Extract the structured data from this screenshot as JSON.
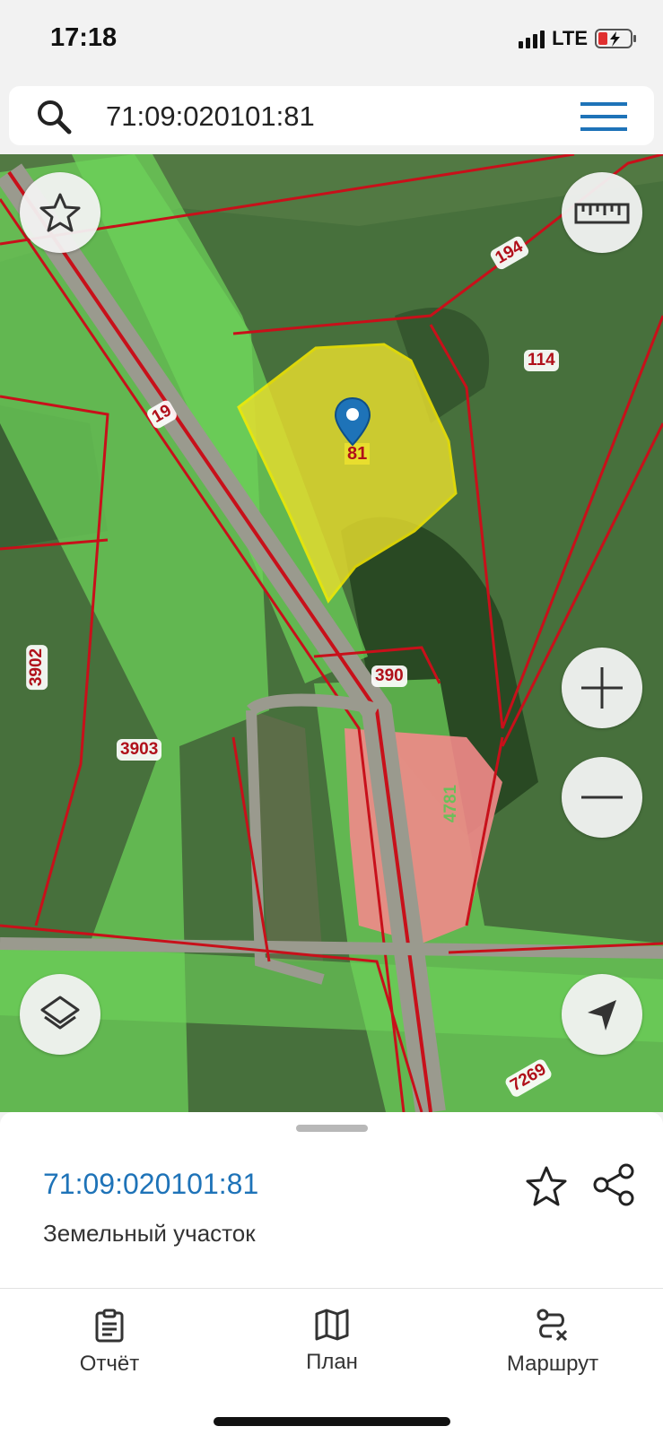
{
  "status_bar": {
    "time": "17:18",
    "network": "LTE"
  },
  "search": {
    "value": "71:09:020101:81"
  },
  "map": {
    "parcel_labels": [
      "194",
      "114",
      "19",
      "81",
      "3902",
      "390",
      "3903",
      "4781",
      "7269"
    ]
  },
  "details": {
    "cadastral_number": "71:09:020101:81",
    "object_type": "Земельный участок"
  },
  "tabs": [
    {
      "label": "Отчёт",
      "icon": "clipboard-icon"
    },
    {
      "label": "План",
      "icon": "map-icon"
    },
    {
      "label": "Маршрут",
      "icon": "route-icon"
    }
  ],
  "colors": {
    "accent": "#1e73b8",
    "parcel_border": "#c8101a",
    "selected_fill": "#e8de2e",
    "zone_green": "#6ed35a",
    "zone_red": "#f28a8a"
  }
}
